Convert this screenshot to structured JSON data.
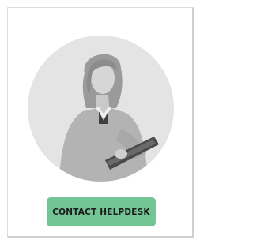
{
  "card": {
    "image_subject": "woman-holding-tablet",
    "button_label": "CONTACT HELPDESK",
    "button_color": "#74c596"
  }
}
